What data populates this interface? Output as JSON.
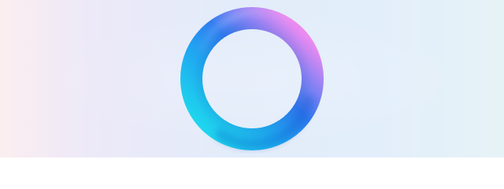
{
  "screen": {
    "element": "loading-ring",
    "state": "loading",
    "colors": {
      "background_left": "#fbeef0",
      "background_mid": "#e3ecfa",
      "background_right": "#e6f3f6",
      "ring_pink": "#f08cf2",
      "ring_violet": "#b58cff",
      "ring_blue": "#2f7df2",
      "ring_deep_blue": "#1f5fe0",
      "ring_cyan": "#1fd8f0",
      "ring_highlight": "#ffffff"
    }
  }
}
